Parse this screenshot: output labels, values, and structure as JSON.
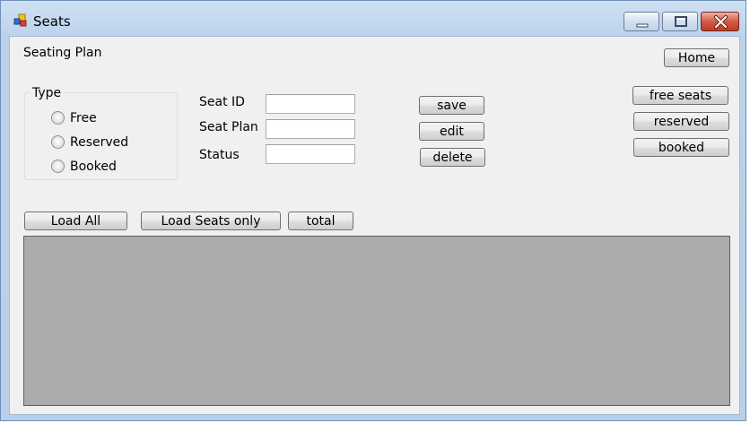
{
  "window": {
    "title": "Seats",
    "app_icon": "forms-app-icon"
  },
  "caption_buttons": {
    "minimize": "minimize-icon",
    "maximize": "maximize-icon",
    "close": "close-icon"
  },
  "form": {
    "heading": "Seating Plan",
    "type_group": {
      "title": "Type",
      "options": [
        "Free",
        "Reserved",
        "Booked"
      ],
      "selected": null
    },
    "fields": {
      "seat_id_label": "Seat ID",
      "seat_id_value": "",
      "seat_plan_label": "Seat Plan",
      "seat_plan_value": "",
      "status_label": "Status",
      "status_value": ""
    },
    "actions": {
      "save": "save",
      "edit": "edit",
      "delete": "delete"
    },
    "filters": {
      "home": "Home",
      "free_seats": "free seats",
      "reserved": "reserved",
      "booked": "booked"
    },
    "load": {
      "load_all": "Load All",
      "load_seats_only": "Load Seats only",
      "total": "total"
    }
  },
  "colors": {
    "grid_background": "#ababab",
    "client_background": "#f0f0f0",
    "close_button": "#c23b21"
  }
}
